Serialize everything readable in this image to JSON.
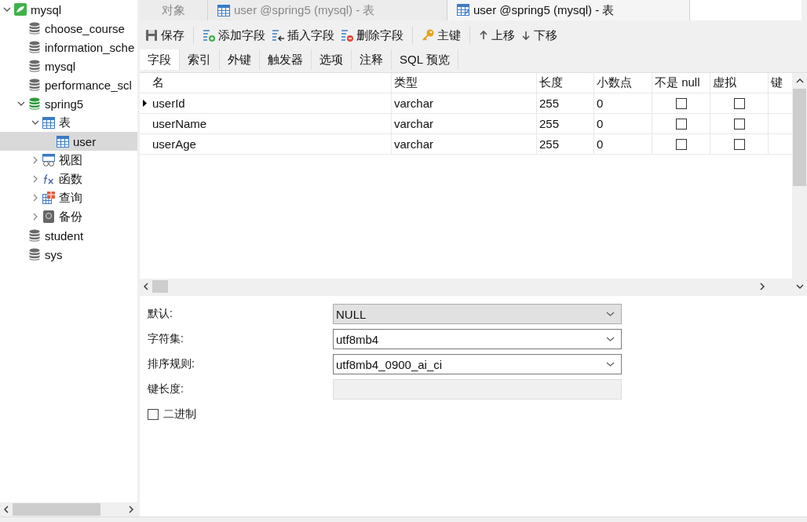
{
  "sidebar": {
    "tree": [
      {
        "label": "mysql",
        "kind": "server",
        "expanded": true,
        "selected": false,
        "children": [
          {
            "label": "choose_course",
            "kind": "database",
            "selected": false
          },
          {
            "label": "information_sche",
            "kind": "database",
            "selected": false
          },
          {
            "label": "mysql",
            "kind": "database",
            "selected": false
          },
          {
            "label": "performance_scl",
            "kind": "database",
            "selected": false
          },
          {
            "label": "spring5",
            "kind": "database-open",
            "expanded": true,
            "selected": false,
            "children": [
              {
                "label": "表",
                "kind": "table",
                "expanded": true,
                "selected": false,
                "children": [
                  {
                    "label": "user",
                    "kind": "table",
                    "selected": true
                  }
                ]
              },
              {
                "label": "视图",
                "kind": "view",
                "expanded": false,
                "selected": false
              },
              {
                "label": "函数",
                "kind": "function",
                "expanded": false,
                "selected": false
              },
              {
                "label": "查询",
                "kind": "query",
                "expanded": false,
                "selected": false
              },
              {
                "label": "备份",
                "kind": "backup",
                "expanded": false,
                "selected": false
              }
            ]
          },
          {
            "label": "student",
            "kind": "database",
            "selected": false
          },
          {
            "label": "sys",
            "kind": "database",
            "selected": false
          }
        ]
      }
    ]
  },
  "tabs": [
    {
      "label": "对象",
      "kind": "plain",
      "selected": false
    },
    {
      "label": "user @spring5 (mysql) - 表",
      "kind": "table",
      "selected": false
    },
    {
      "label": "user @spring5 (mysql) - 表",
      "kind": "design",
      "selected": true
    }
  ],
  "toolbar": [
    {
      "label": "保存",
      "kind": "save"
    },
    {
      "label": "添加字段",
      "kind": "add"
    },
    {
      "label": "插入字段",
      "kind": "insert"
    },
    {
      "label": "删除字段",
      "kind": "delete"
    },
    {
      "label": "主键",
      "kind": "key"
    },
    {
      "label": "上移",
      "kind": "up"
    },
    {
      "label": "下移",
      "kind": "down"
    }
  ],
  "subtabs": [
    {
      "label": "字段",
      "selected": true
    },
    {
      "label": "索引",
      "selected": false
    },
    {
      "label": "外键",
      "selected": false
    },
    {
      "label": "触发器",
      "selected": false
    },
    {
      "label": "选项",
      "selected": false
    },
    {
      "label": "注释",
      "selected": false
    },
    {
      "label": "SQL 预览",
      "selected": false
    }
  ],
  "table": {
    "columns": [
      "名",
      "类型",
      "长度",
      "小数点",
      "不是 null",
      "虚拟",
      "键"
    ],
    "rows": [
      {
        "current": true,
        "name": "userId",
        "type": "varchar",
        "length": "255",
        "decimals": "0",
        "not_null": false,
        "virtual": false
      },
      {
        "current": false,
        "name": "userName",
        "type": "varchar",
        "length": "255",
        "decimals": "0",
        "not_null": false,
        "virtual": false
      },
      {
        "current": false,
        "name": "userAge",
        "type": "varchar",
        "length": "255",
        "decimals": "0",
        "not_null": false,
        "virtual": false
      }
    ]
  },
  "properties": [
    {
      "kind": "select",
      "label": "默认:",
      "value": "NULL",
      "disabled": true
    },
    {
      "kind": "select",
      "label": "字符集:",
      "value": "utf8mb4",
      "disabled": false
    },
    {
      "kind": "select",
      "label": "排序规则:",
      "value": "utf8mb4_0900_ai_ci",
      "disabled": false
    },
    {
      "kind": "readonly",
      "label": "键长度:"
    },
    {
      "kind": "checkbox",
      "label": "二进制",
      "checked": false
    }
  ]
}
